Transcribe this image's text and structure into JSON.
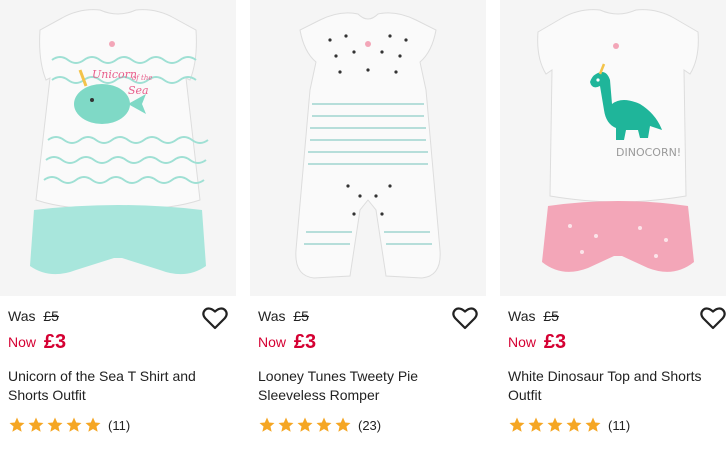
{
  "products": [
    {
      "name": "Unicorn of the Sea T Shirt and Shorts Outfit",
      "was_label": "Was",
      "was_price": "£5",
      "now_label": "Now",
      "now_price": "£3",
      "rating_stars": 5,
      "review_count": "(11)",
      "image_text_line1": "Unicorn",
      "image_text_line2": "of the",
      "image_text_line3": "Sea"
    },
    {
      "name": "Looney Tunes Tweety Pie Sleeveless Romper",
      "was_label": "Was",
      "was_price": "£5",
      "now_label": "Now",
      "now_price": "£3",
      "rating_stars": 5,
      "review_count": "(23)"
    },
    {
      "name": "White Dinosaur Top and Shorts Outfit",
      "was_label": "Was",
      "was_price": "£5",
      "now_label": "Now",
      "now_price": "£3",
      "rating_stars": 5,
      "review_count": "(11)",
      "image_text": "DINOCORN!"
    }
  ],
  "colors": {
    "sale_red": "#d50032",
    "star_gold": "#f5a623",
    "mint": "#a8e6dc",
    "pink": "#f3a6b8",
    "teal_dino": "#1fb59a"
  },
  "icons": {
    "wishlist": "heart-outline-icon",
    "rating": "star-icon"
  }
}
